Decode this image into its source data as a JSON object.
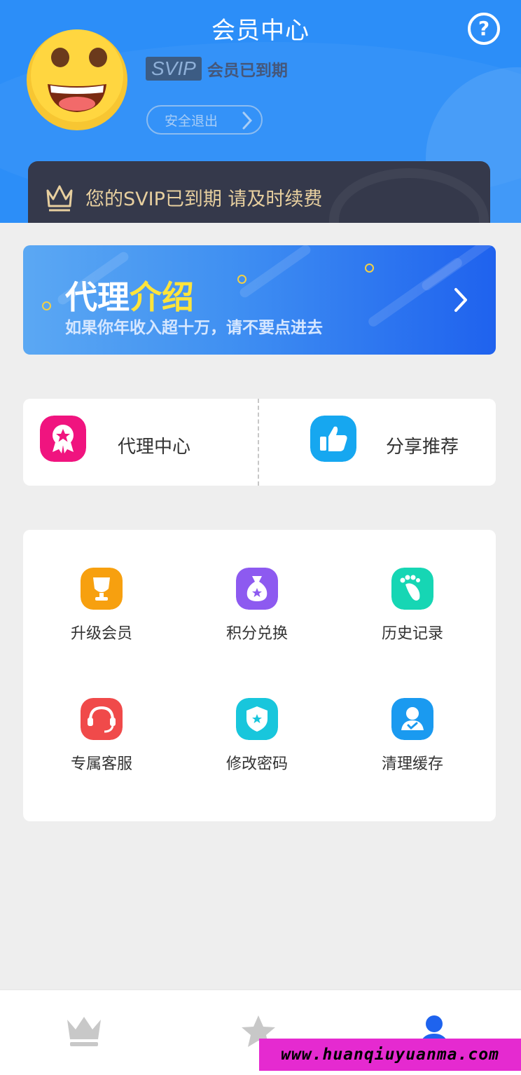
{
  "header": {
    "title": "会员中心",
    "help_glyph": "?",
    "svip_badge": "SVIP",
    "membership_status": "会员已到期",
    "logout_label": "安全退出",
    "expire_notice": "您的SVIP已到期 请及时续费"
  },
  "banner": {
    "title_white": "代理",
    "title_yellow": "介绍",
    "subtitle": "如果你年收入超十万，请不要点进去"
  },
  "quick_links": [
    {
      "label": "代理中心",
      "icon": "badge-star-icon",
      "color": "#f0147f"
    },
    {
      "label": "分享推荐",
      "icon": "thumbs-up-icon",
      "color": "#16a7f0"
    }
  ],
  "grid": [
    {
      "label": "升级会员",
      "icon": "trophy-icon",
      "color": "#f7a00f"
    },
    {
      "label": "积分兑换",
      "icon": "money-bag-icon",
      "color": "#8d5af0"
    },
    {
      "label": "历史记录",
      "icon": "footprint-icon",
      "color": "#16d6b4"
    },
    {
      "label": "专属客服",
      "icon": "headset-icon",
      "color": "#f04a4a"
    },
    {
      "label": "修改密码",
      "icon": "shield-icon",
      "color": "#18c6dc"
    },
    {
      "label": "清理缓存",
      "icon": "person-icon",
      "color": "#1a9af0"
    }
  ],
  "tabs": [
    {
      "icon": "crown-icon",
      "active": false
    },
    {
      "icon": "star-icon",
      "active": false
    },
    {
      "icon": "user-icon",
      "active": true
    }
  ],
  "colors": {
    "header_bg": "#2c8ef8",
    "accent_yellow": "#ffe43b",
    "gold_text": "#e7cf9f",
    "tab_active": "#1e63ee",
    "tab_inactive": "#c8c8c8"
  },
  "watermark": "www.huanqiuyuanma.com"
}
